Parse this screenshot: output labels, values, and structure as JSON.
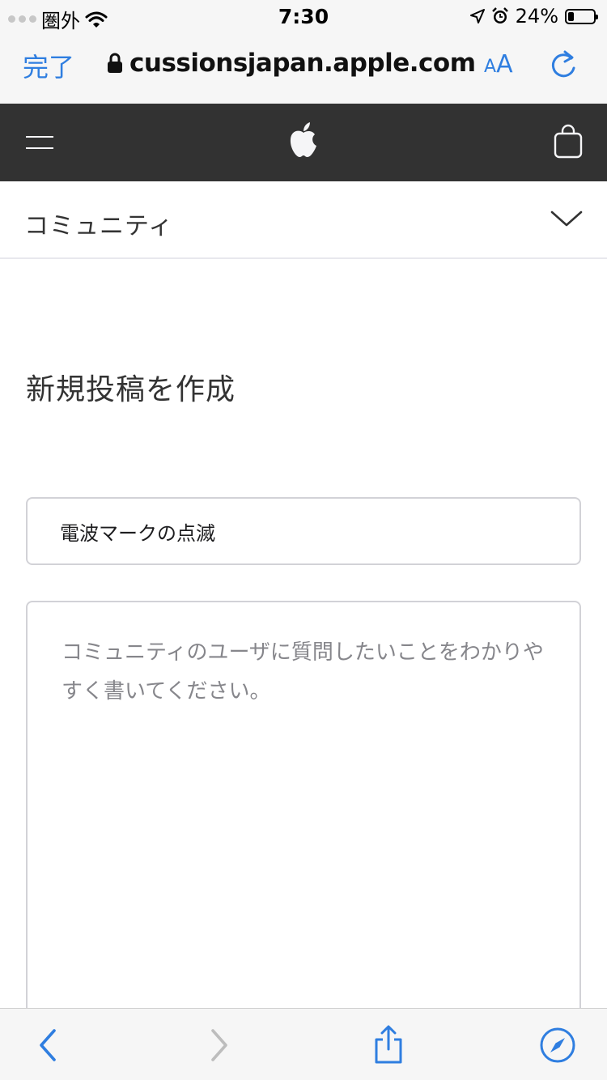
{
  "status_bar": {
    "carrier": "圏外",
    "time": "7:30",
    "battery_percent": "24%",
    "battery_level": 0.24
  },
  "browser": {
    "done_label": "完了",
    "url": "cussionsjapan.apple.com",
    "text_size_small": "A",
    "text_size_big": "A",
    "accent_color": "#2f7ee0"
  },
  "nav": {
    "background_color": "#323232",
    "icons": [
      "menu-icon",
      "apple-logo",
      "bag-icon"
    ]
  },
  "community": {
    "label": "コミュニティ"
  },
  "form": {
    "heading": "新規投稿を作成",
    "title_value": "電波マークの点滅",
    "body_placeholder": "コミュニティのユーザに質問したいことをわかりやすく書いてください。"
  },
  "toolbar": {
    "icons": [
      "back-icon",
      "forward-icon",
      "share-icon",
      "compass-icon"
    ]
  }
}
